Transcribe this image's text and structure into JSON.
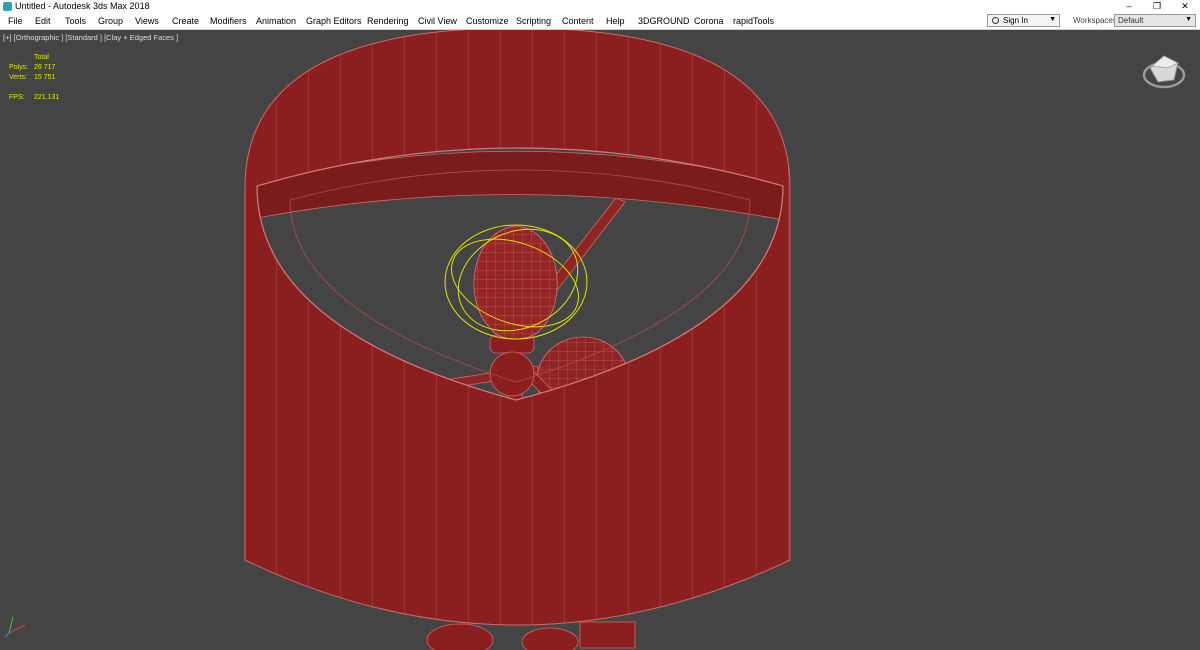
{
  "window": {
    "title": "Untitled - Autodesk 3ds Max 2018",
    "controls": {
      "minimize": "–",
      "restore": "❐",
      "close": "✕"
    }
  },
  "menu": [
    "File",
    "Edit",
    "Tools",
    "Group",
    "Views",
    "Create",
    "Modifiers",
    "Animation",
    "Graph Editors",
    "Rendering",
    "Civil View",
    "Customize",
    "Scripting",
    "Content",
    "Help",
    "3DGROUND",
    "Corona",
    "rapidTools"
  ],
  "account": {
    "signin_label": "Sign In"
  },
  "workspaces": {
    "label": "Workspaces:",
    "value": "Default"
  },
  "viewport": {
    "label": "[+] [Orthographic ] [Standard ] [Clay + Edged Faces ]",
    "stats": {
      "total_label": "Total",
      "polys_label": "Polys:",
      "polys_value": "26 717",
      "verts_label": "Verts:",
      "verts_value": "15 751",
      "fps_label": "FPS:",
      "fps_value": "221,131"
    }
  },
  "colors": {
    "viewport_bg": "#444444",
    "model_fill": "#8b1e1e",
    "model_edge": "#d06a6a",
    "selection": "#e0e000",
    "stats_text": "#e8e800"
  }
}
